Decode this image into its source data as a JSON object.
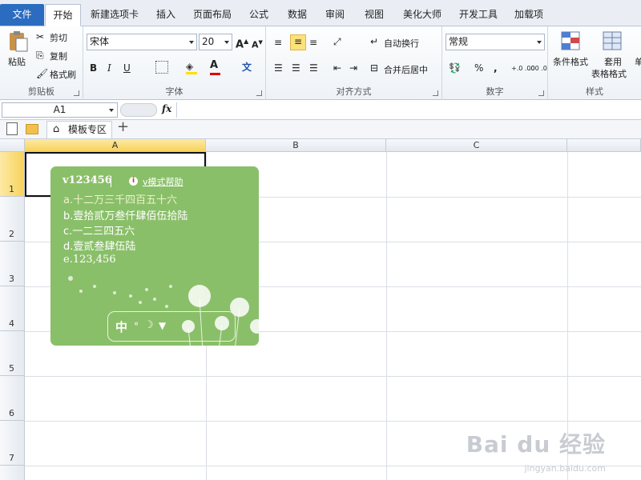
{
  "tabs": [
    {
      "label": "文件",
      "kind": "file"
    },
    {
      "label": "开始",
      "kind": "active"
    },
    {
      "label": "新建选项卡",
      "kind": ""
    },
    {
      "label": "插入",
      "kind": ""
    },
    {
      "label": "页面布局",
      "kind": ""
    },
    {
      "label": "公式",
      "kind": ""
    },
    {
      "label": "数据",
      "kind": ""
    },
    {
      "label": "审阅",
      "kind": ""
    },
    {
      "label": "视图",
      "kind": ""
    },
    {
      "label": "美化大师",
      "kind": ""
    },
    {
      "label": "开发工具",
      "kind": ""
    },
    {
      "label": "加载项",
      "kind": ""
    }
  ],
  "clipboard": {
    "label": "剪贴板",
    "paste": "粘贴",
    "cut": "剪切",
    "copy": "复制",
    "format_painter": "格式刷"
  },
  "font": {
    "label": "字体",
    "name": "宋体",
    "size": "20",
    "bold": "B",
    "italic": "I",
    "underline": "U",
    "font_color_letter": "A",
    "phonetic": "文"
  },
  "alignment": {
    "label": "对齐方式",
    "wrap": "自动换行",
    "merge": "合并后居中"
  },
  "number": {
    "label": "数字",
    "format": "常规",
    "percent": "%",
    "comma": ",",
    "inc_decimal": "+.0 .00",
    "dec_decimal": ".00 .0"
  },
  "styles": {
    "label": "样式",
    "conditional": "条件格式",
    "table_line1": "套用",
    "table_line2": "表格格式",
    "cell_partial": "单"
  },
  "formula_bar": {
    "name_box": "A1",
    "fx": "fx",
    "value": ""
  },
  "doc_tabs": [
    {
      "label": "模板专区"
    }
  ],
  "grid": {
    "columns": [
      "A",
      "B",
      "C"
    ],
    "rows": [
      "1",
      "2",
      "3",
      "4",
      "5",
      "6",
      "7"
    ],
    "selected_cell": "A1"
  },
  "ime": {
    "input_code": "v123456",
    "help_label": "v模式帮助",
    "candidates": [
      "a.十二万三千四百五十六",
      "b.壹拾贰万叁仟肆佰伍拾陆",
      "c.一二三四五六",
      "d.壹贰叁肆伍陆",
      "e.123,456"
    ],
    "status_mode": "中"
  },
  "watermark": {
    "brand": "Bai du 经验",
    "url": "jingyan.baidu.com"
  },
  "colors": {
    "file_tab": "#2c6cc0",
    "ime_bg": "#8abf69",
    "header_selected": "#f7d35a"
  }
}
